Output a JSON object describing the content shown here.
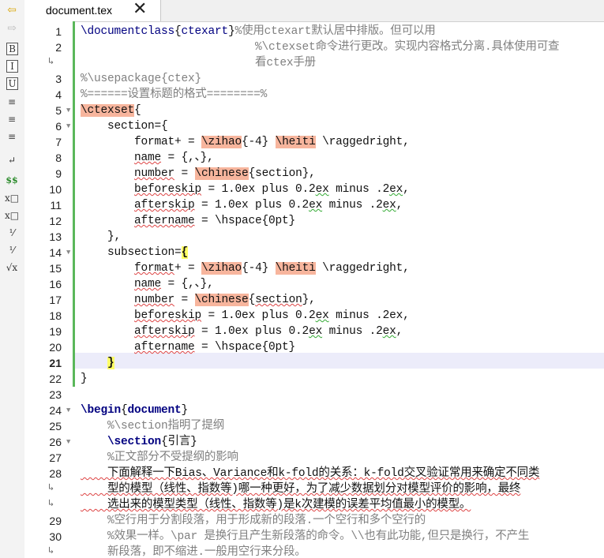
{
  "tab": {
    "title": "document.tex",
    "close": "✕"
  },
  "sidebar": [
    {
      "name": "nav-back-icon",
      "glyph": "⇦"
    },
    {
      "name": "nav-forward-icon",
      "glyph": "⇨"
    },
    {
      "name": "bold-icon",
      "glyph": "B"
    },
    {
      "name": "italic-icon",
      "glyph": "I"
    },
    {
      "name": "underline-icon",
      "glyph": "U"
    },
    {
      "name": "align-left-icon",
      "glyph": "≡"
    },
    {
      "name": "align-center-icon",
      "glyph": "≡"
    },
    {
      "name": "align-right-icon",
      "glyph": "≡"
    },
    {
      "name": "newline-icon",
      "glyph": "↵"
    },
    {
      "name": "math-mode-icon",
      "glyph": "$$"
    },
    {
      "name": "subscript-icon",
      "glyph": "x□"
    },
    {
      "name": "superscript-icon",
      "glyph": "x□"
    },
    {
      "name": "fraction-icon",
      "glyph": "⅟"
    },
    {
      "name": "dfrac-icon",
      "glyph": "⅟"
    },
    {
      "name": "sqrt-icon",
      "glyph": "√x"
    }
  ],
  "gutter": [
    {
      "n": "1"
    },
    {
      "n": "2"
    },
    {
      "n": "↳"
    },
    {
      "n": "3"
    },
    {
      "n": "4"
    },
    {
      "n": "5"
    },
    {
      "n": "6"
    },
    {
      "n": "7"
    },
    {
      "n": "8"
    },
    {
      "n": "9"
    },
    {
      "n": "10"
    },
    {
      "n": "11"
    },
    {
      "n": "12"
    },
    {
      "n": "13"
    },
    {
      "n": "14"
    },
    {
      "n": "15"
    },
    {
      "n": "16"
    },
    {
      "n": "17"
    },
    {
      "n": "18"
    },
    {
      "n": "19"
    },
    {
      "n": "20"
    },
    {
      "n": "21"
    },
    {
      "n": "22"
    },
    {
      "n": "23"
    },
    {
      "n": "24"
    },
    {
      "n": "25"
    },
    {
      "n": "26"
    },
    {
      "n": "27"
    },
    {
      "n": "28"
    },
    {
      "n": "↳"
    },
    {
      "n": "↳"
    },
    {
      "n": "29"
    },
    {
      "n": "30"
    },
    {
      "n": "↳"
    }
  ],
  "code": [
    [
      [
        "kw",
        "\\documentclass"
      ],
      [
        "",
        "{"
      ],
      [
        "arg",
        "ctexart"
      ],
      [
        "",
        "}"
      ],
      [
        "cm",
        "%使用ctexart默认居中排版。但可以用"
      ]
    ],
    [
      [
        "cm",
        "                          %\\ctexset命令进行更改。实现内容格式分离.具体使用可查"
      ]
    ],
    [
      [
        "cm",
        "                          看ctex手册"
      ]
    ],
    [
      [
        "cm",
        "%\\usepackage{ctex}"
      ]
    ],
    [
      [
        "cm",
        "%======设置标题的格式========%"
      ]
    ],
    [
      [
        "hl",
        "\\ctexset"
      ],
      [
        "",
        "{"
      ]
    ],
    [
      [
        "",
        "    section={"
      ]
    ],
    [
      [
        "",
        "        format+ = "
      ],
      [
        "hl",
        "\\zihao"
      ],
      [
        "",
        "{-4} "
      ],
      [
        "hl",
        "\\heiti"
      ],
      [
        "",
        " \\raggedright,"
      ]
    ],
    [
      [
        "",
        "        "
      ],
      [
        "sq",
        "name"
      ],
      [
        "",
        " = {,、},"
      ]
    ],
    [
      [
        "",
        "        "
      ],
      [
        "sq",
        "number"
      ],
      [
        "",
        " = "
      ],
      [
        "hl",
        "\\chinese"
      ],
      [
        "",
        "{section},"
      ]
    ],
    [
      [
        "",
        "        "
      ],
      [
        "sq",
        "beforeskip"
      ],
      [
        "",
        " = 1.0ex plus 0.2"
      ],
      [
        "sqg",
        "ex"
      ],
      [
        "",
        " minus .2"
      ],
      [
        "sqg",
        "ex"
      ],
      [
        "",
        ","
      ]
    ],
    [
      [
        "",
        "        "
      ],
      [
        "sq",
        "afterskip"
      ],
      [
        "",
        " = 1.0ex plus 0.2"
      ],
      [
        "sqg",
        "ex"
      ],
      [
        "",
        " minus .2"
      ],
      [
        "sqg",
        "ex"
      ],
      [
        "",
        ","
      ]
    ],
    [
      [
        "",
        "        "
      ],
      [
        "sq",
        "aftername"
      ],
      [
        "",
        " = \\hspace{0pt}"
      ]
    ],
    [
      [
        "",
        "    },"
      ]
    ],
    [
      [
        "",
        "    subsection="
      ],
      [
        "br",
        "{"
      ]
    ],
    [
      [
        "",
        "        "
      ],
      [
        "sq",
        "format"
      ],
      [
        "",
        "+ = "
      ],
      [
        "hl",
        "\\zihao"
      ],
      [
        "",
        "{-4} "
      ],
      [
        "hl",
        "\\heiti"
      ],
      [
        "",
        " \\raggedright,"
      ]
    ],
    [
      [
        "",
        "        "
      ],
      [
        "sq",
        "name"
      ],
      [
        "",
        " = {,、},"
      ]
    ],
    [
      [
        "",
        "        "
      ],
      [
        "sq",
        "number"
      ],
      [
        "",
        " = "
      ],
      [
        "hl",
        "\\chinese"
      ],
      [
        "",
        "{"
      ],
      [
        "sq",
        "section"
      ],
      [
        "",
        "},"
      ]
    ],
    [
      [
        "",
        "        "
      ],
      [
        "sq",
        "beforeskip"
      ],
      [
        "",
        " = 1.0ex plus 0.2"
      ],
      [
        "sqg",
        "ex"
      ],
      [
        "",
        " minus .2ex,"
      ]
    ],
    [
      [
        "",
        "        "
      ],
      [
        "sq",
        "afterskip"
      ],
      [
        "",
        " = 1.0ex plus 0.2"
      ],
      [
        "sqg",
        "ex"
      ],
      [
        "",
        " minus .2"
      ],
      [
        "sqg",
        "ex"
      ],
      [
        "",
        ","
      ]
    ],
    [
      [
        "",
        "        "
      ],
      [
        "sq",
        "aftername"
      ],
      [
        "",
        " = \\hspace{0pt}"
      ]
    ],
    [
      [
        "",
        "    "
      ],
      [
        "br",
        "}"
      ]
    ],
    [
      [
        "",
        "}"
      ]
    ],
    [
      [
        "",
        ""
      ]
    ],
    [
      [
        "b",
        "\\begin"
      ],
      [
        "",
        "{"
      ],
      [
        "b",
        "document"
      ],
      [
        "",
        "}"
      ]
    ],
    [
      [
        "cm",
        "    %\\section指明了提纲"
      ]
    ],
    [
      [
        "",
        "    "
      ],
      [
        "b",
        "\\section"
      ],
      [
        "",
        "{引言}"
      ]
    ],
    [
      [
        "cm",
        "    %正文部分不受提纲的影响"
      ]
    ],
    [
      [
        "sq",
        "    下面解释一下Bias、Variance和k-fold的关系：k-fold交叉验证常用来确定不同类"
      ]
    ],
    [
      [
        "sq",
        "    型的模型（线性、指数等)哪一种更好，为了减少数据划分对模型评价的影响，最终"
      ]
    ],
    [
      [
        "sq",
        "    选出来的模型类型（线性、指数等)是k次建模的误差平均值最小的模型。"
      ]
    ],
    [
      [
        "cm",
        "    %空行用于分割段落，用于形成新的段落.一个空行和多个空行的"
      ]
    ],
    [
      [
        "cm",
        "    %效果一样。\\par 是换行且产生新段落的命令。\\\\也有此功能,但只是换行，不产生"
      ]
    ],
    [
      [
        "cm",
        "    新段落，即不缩进.一般用空行来分段。"
      ]
    ]
  ]
}
